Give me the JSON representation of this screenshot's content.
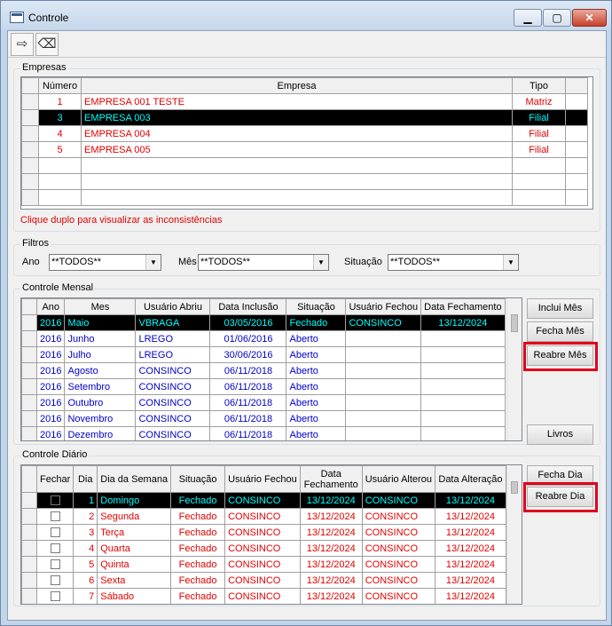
{
  "window": {
    "title": "Controle"
  },
  "toolbar": {
    "exit_icon": "exit-icon",
    "eraser_icon": "eraser-icon"
  },
  "empresas": {
    "label": "Empresas",
    "headers": [
      "Número",
      "Empresa",
      "Tipo"
    ],
    "rows": [
      {
        "numero": "1",
        "empresa": "EMPRESA 001 TESTE",
        "tipo": "Matriz"
      },
      {
        "numero": "3",
        "empresa": "EMPRESA 003",
        "tipo": "Filial"
      },
      {
        "numero": "4",
        "empresa": "EMPRESA 004",
        "tipo": "Filial"
      },
      {
        "numero": "5",
        "empresa": "EMPRESA 005",
        "tipo": "Filial"
      }
    ],
    "hint": "Clique duplo para visualizar as inconsistências"
  },
  "filtros": {
    "label": "Filtros",
    "ano_label": "Ano",
    "ano_value": "**TODOS**",
    "mes_label": "Mês",
    "mes_value": "**TODOS**",
    "situacao_label": "Situação",
    "situacao_value": "**TODOS**"
  },
  "mensal": {
    "label": "Controle Mensal",
    "headers": [
      "Ano",
      "Mes",
      "Usuário Abriu",
      "Data Inclusão",
      "Situação",
      "Usuário Fechou",
      "Data Fechamento"
    ],
    "rows": [
      [
        "2016",
        "Maio",
        "VBRAGA",
        "03/05/2016",
        "Fechado",
        "CONSINCO",
        "13/12/2024"
      ],
      [
        "2016",
        "Junho",
        "LREGO",
        "01/06/2016",
        "Aberto",
        "",
        ""
      ],
      [
        "2016",
        "Julho",
        "LREGO",
        "30/06/2016",
        "Aberto",
        "",
        ""
      ],
      [
        "2016",
        "Agosto",
        "CONSINCO",
        "06/11/2018",
        "Aberto",
        "",
        ""
      ],
      [
        "2016",
        "Setembro",
        "CONSINCO",
        "06/11/2018",
        "Aberto",
        "",
        ""
      ],
      [
        "2016",
        "Outubro",
        "CONSINCO",
        "06/11/2018",
        "Aberto",
        "",
        ""
      ],
      [
        "2016",
        "Novembro",
        "CONSINCO",
        "06/11/2018",
        "Aberto",
        "",
        ""
      ],
      [
        "2016",
        "Dezembro",
        "CONSINCO",
        "06/11/2018",
        "Aberto",
        "",
        ""
      ]
    ],
    "buttons": {
      "inclui": "Inclui Mês",
      "fecha": "Fecha Mês",
      "reabre": "Reabre Mês",
      "livros": "Livros"
    }
  },
  "diario": {
    "label": "Controle Diário",
    "headers": [
      "Fechar",
      "Dia",
      "Dia da Semana",
      "Situação",
      "Usuário Fechou",
      "Data Fechamento",
      "Usuário Alterou",
      "Data Alteração"
    ],
    "rows": [
      [
        "1",
        "Domingo",
        "Fechado",
        "CONSINCO",
        "13/12/2024",
        "CONSINCO",
        "13/12/2024"
      ],
      [
        "2",
        "Segunda",
        "Fechado",
        "CONSINCO",
        "13/12/2024",
        "CONSINCO",
        "13/12/2024"
      ],
      [
        "3",
        "Terça",
        "Fechado",
        "CONSINCO",
        "13/12/2024",
        "CONSINCO",
        "13/12/2024"
      ],
      [
        "4",
        "Quarta",
        "Fechado",
        "CONSINCO",
        "13/12/2024",
        "CONSINCO",
        "13/12/2024"
      ],
      [
        "5",
        "Quinta",
        "Fechado",
        "CONSINCO",
        "13/12/2024",
        "CONSINCO",
        "13/12/2024"
      ],
      [
        "6",
        "Sexta",
        "Fechado",
        "CONSINCO",
        "13/12/2024",
        "CONSINCO",
        "13/12/2024"
      ],
      [
        "7",
        "Sábado",
        "Fechado",
        "CONSINCO",
        "13/12/2024",
        "CONSINCO",
        "13/12/2024"
      ]
    ],
    "buttons": {
      "fecha": "Fecha Dia",
      "reabre": "Reabre Dia"
    }
  },
  "colors": {
    "red": "#e00000",
    "blue": "#0000c8",
    "selection_bg": "#000000",
    "selection_fg": "#00ffff",
    "highlight": "#e0001c"
  }
}
